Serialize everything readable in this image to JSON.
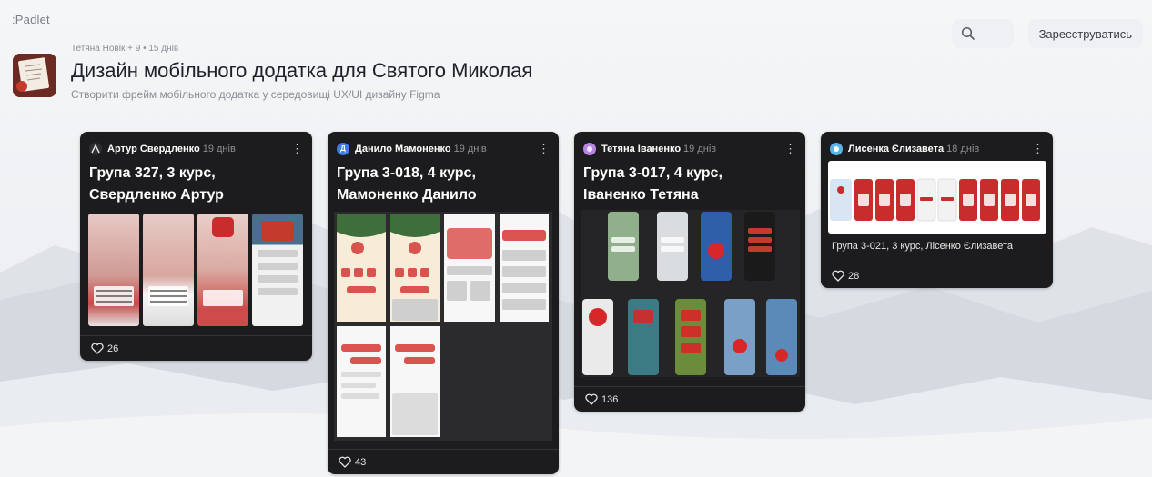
{
  "app": {
    "logo": ":Padlet"
  },
  "topbar": {
    "search_icon": "search-icon",
    "signup_label": "Зареєструватись"
  },
  "board": {
    "meta": "Тетяна Новік + 9 • 15 днів",
    "title": "Дизайн мобільного додатка для Святого Миколая",
    "description": "Створити фрейм мобільного додатка у середовищі UX/UI дизайну Figma"
  },
  "posts": [
    {
      "author": "Артур Свердленко",
      "age": "19 днів",
      "title_line1": "Група 327, 3 курс,",
      "title_line2": "Свердленко Артур",
      "likes": "26",
      "avatar_color": "#2d2d2d"
    },
    {
      "author": "Данило Мамоненко",
      "age": "19 днів",
      "title_line1": "Група 3-018, 4 курс,",
      "title_line2": "Мамоненко Данило",
      "likes": "43",
      "avatar_color": "#3f7be0",
      "avatar_letter": "Д"
    },
    {
      "author": "Тетяна Іваненко",
      "age": "19 днів",
      "title_line1": "Група 3-017, 4 курс,",
      "title_line2": "Іваненко Тетяна",
      "likes": "136",
      "avatar_color": "#b784e0"
    },
    {
      "author": "Лисенка Єлизавета",
      "age": "18 днів",
      "caption": "Група 3-021, 3 курс, Лісенко Єлизавета",
      "likes": "28",
      "avatar_color": "#5ab5e6"
    }
  ],
  "colors": {
    "card_bg": "#1c1c1e",
    "accent_red": "#d62828",
    "page_bg": "#eef0f3"
  }
}
